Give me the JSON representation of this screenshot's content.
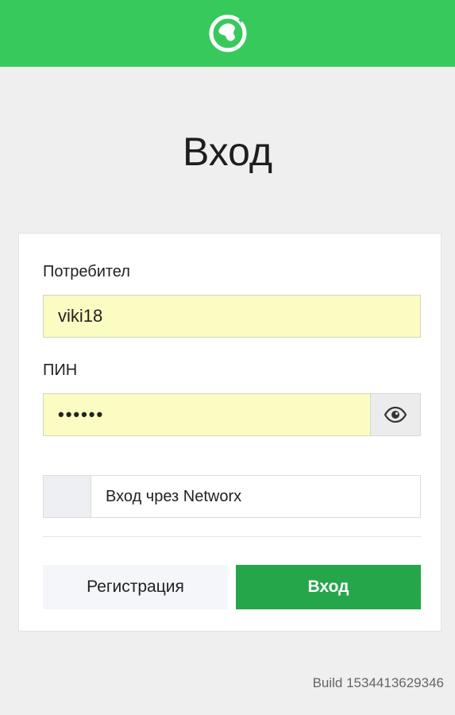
{
  "header": {
    "logo_icon": "globe-logo-icon",
    "background_color": "#37c95c"
  },
  "page": {
    "title": "Вход"
  },
  "form": {
    "username": {
      "label": "Потребител",
      "value": "viki18"
    },
    "pin": {
      "label": "ПИН",
      "masked_value": "••••••",
      "toggle_icon": "eye-icon"
    },
    "networx_option": {
      "label": "Вход чрез Networx",
      "checked": false
    },
    "buttons": {
      "register_label": "Регистрация",
      "login_label": "Вход",
      "login_color": "#26a64b"
    }
  },
  "footer": {
    "build": "Build 1534413629346"
  }
}
